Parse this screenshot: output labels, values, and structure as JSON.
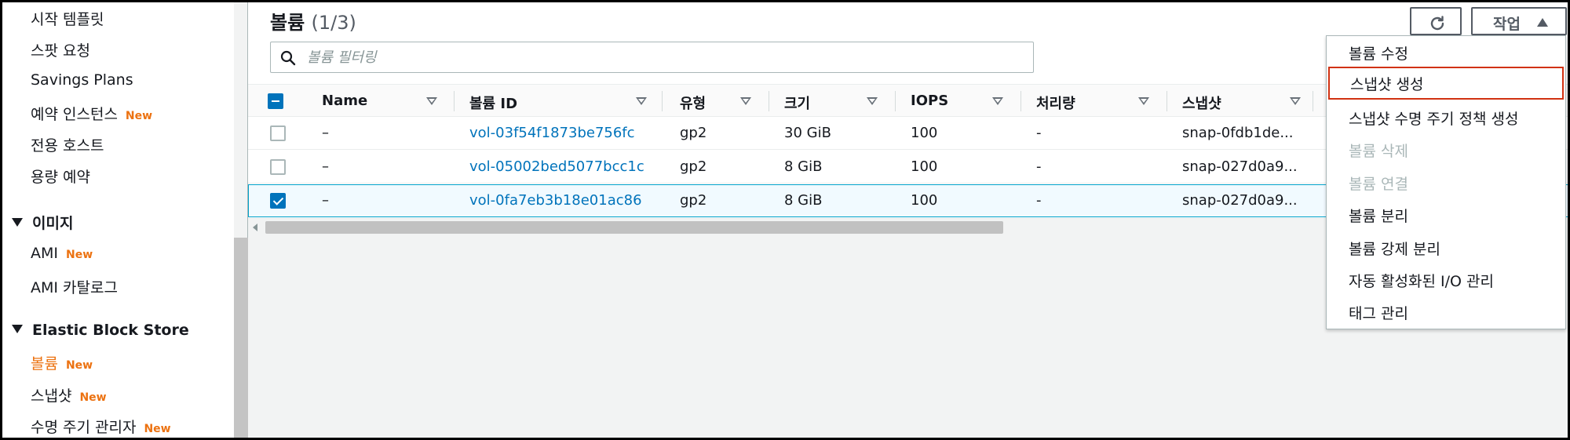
{
  "sidebar": {
    "items_top": [
      {
        "label": "시작 템플릿",
        "badge": ""
      },
      {
        "label": "스팟 요청",
        "badge": ""
      },
      {
        "label": "Savings Plans",
        "badge": ""
      },
      {
        "label": "예약 인스턴스",
        "badge": "New"
      },
      {
        "label": "전용 호스트",
        "badge": ""
      },
      {
        "label": "용량 예약",
        "badge": ""
      }
    ],
    "section_images": {
      "title": "이미지",
      "items": [
        {
          "label": "AMI",
          "badge": "New"
        },
        {
          "label": "AMI 카탈로그",
          "badge": ""
        }
      ]
    },
    "section_ebs": {
      "title": "Elastic Block Store",
      "items": [
        {
          "label": "볼륨",
          "badge": "New"
        },
        {
          "label": "스냅샷",
          "badge": "New"
        },
        {
          "label": "수명 주기 관리자",
          "badge": "New"
        }
      ]
    }
  },
  "header": {
    "title": "볼륨",
    "count": "(1/3)",
    "refresh_icon": "refresh-icon",
    "actions_label": "작업"
  },
  "search": {
    "placeholder": "볼륨 필터링",
    "value": ""
  },
  "table": {
    "columns": [
      "Name",
      "볼륨 ID",
      "유형",
      "크기",
      "IOPS",
      "처리량",
      "스냅샷"
    ],
    "rows": [
      {
        "selected": false,
        "name": "–",
        "volume_id": "vol-03f54f1873be756fc",
        "type": "gp2",
        "size": "30 GiB",
        "iops": "100",
        "throughput": "-",
        "snapshot": "snap-0fdb1de..."
      },
      {
        "selected": false,
        "name": "–",
        "volume_id": "vol-05002bed5077bcc1c",
        "type": "gp2",
        "size": "8 GiB",
        "iops": "100",
        "throughput": "-",
        "snapshot": "snap-027d0a9..."
      },
      {
        "selected": true,
        "name": "–",
        "volume_id": "vol-0fa7eb3b18e01ac86",
        "type": "gp2",
        "size": "8 GiB",
        "iops": "100",
        "throughput": "-",
        "snapshot": "snap-027d0a9..."
      }
    ]
  },
  "actions_menu": {
    "items": [
      {
        "label": "볼륨 수정",
        "disabled": false,
        "highlighted": false
      },
      {
        "label": "스냅샷 생성",
        "disabled": false,
        "highlighted": true
      },
      {
        "label": "스냅샷 수명 주기 정책 생성",
        "disabled": false,
        "highlighted": false
      },
      {
        "label": "볼륨 삭제",
        "disabled": true,
        "highlighted": false
      },
      {
        "label": "볼륨 연결",
        "disabled": true,
        "highlighted": false
      },
      {
        "label": "볼륨 분리",
        "disabled": false,
        "highlighted": false
      },
      {
        "label": "볼륨 강제 분리",
        "disabled": false,
        "highlighted": false
      },
      {
        "label": "자동 활성화된 I/O 관리",
        "disabled": false,
        "highlighted": false
      },
      {
        "label": "태그 관리",
        "disabled": false,
        "highlighted": false
      }
    ]
  },
  "colors": {
    "accent_orange": "#ec7211",
    "link_blue": "#0073bb",
    "highlight_red": "#d13212"
  }
}
